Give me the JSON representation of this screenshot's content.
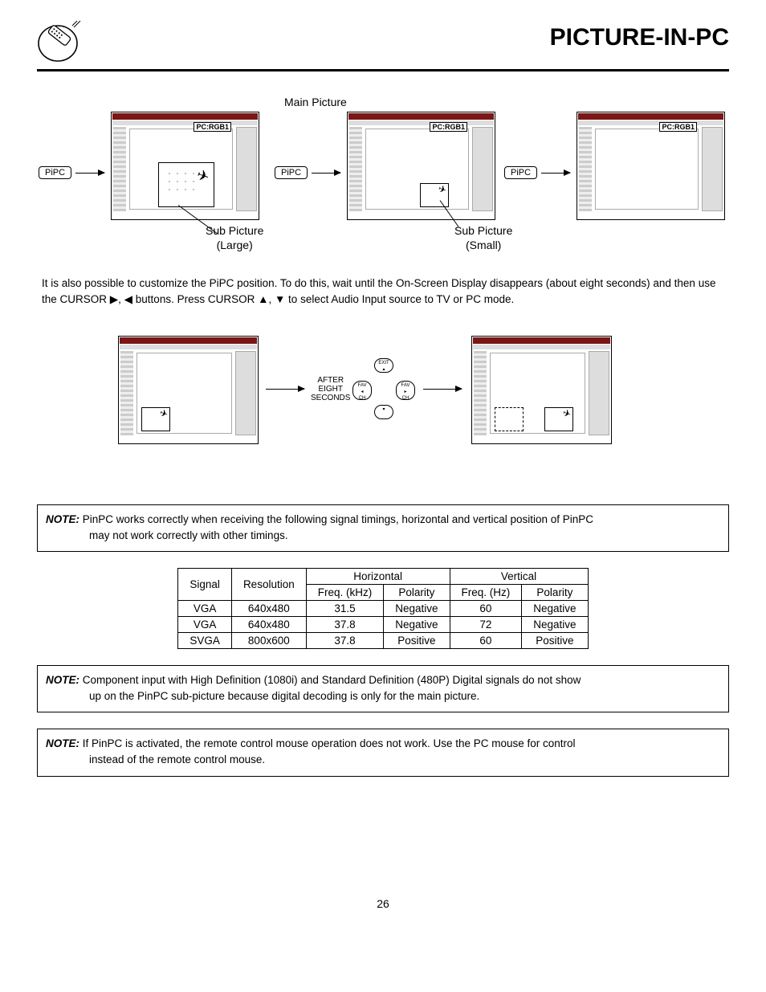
{
  "header": {
    "title": "PICTURE-IN-PC"
  },
  "diagram1": {
    "main_picture_label": "Main Picture",
    "pipc_button": "PiPC",
    "badge": "PC:RGB1",
    "sub_large_label_line1": "Sub Picture",
    "sub_large_label_line2": "(Large)",
    "sub_small_label_line1": "Sub Picture",
    "sub_small_label_line2": "(Small)"
  },
  "paragraph": "It is also possible to customize the PiPC position. To do this, wait until the On-Screen Display disappears (about eight seconds) and then use the CURSOR ▶, ◀ buttons. Press CURSOR ▲, ▼ to select Audio Input source to TV or PC mode.",
  "diagram2": {
    "after_label": "AFTER\nEIGHT\nSECONDS",
    "dpad": {
      "up": "EXIT\n▴",
      "left": "FAV\n◂\nCH",
      "right": "FAV\n▸\nCH",
      "down": "▾"
    }
  },
  "notes": {
    "label": "NOTE:",
    "note1": "PinPC works correctly when receiving the following signal timings, horizontal and vertical position of PinPC may not work correctly with other timings.",
    "note2": "Component input with High Definition (1080i) and Standard Definition (480P) Digital signals do not show up on the PinPC sub-picture because digital decoding is only for the main picture.",
    "note3": "If PinPC is activated, the remote control mouse operation does not work.  Use the PC mouse for control instead of the remote control mouse."
  },
  "table": {
    "headers": {
      "signal": "Signal",
      "resolution": "Resolution",
      "horizontal": "Horizontal",
      "vertical": "Vertical",
      "freq_khz": "Freq. (kHz)",
      "polarity": "Polarity",
      "freq_hz": "Freq. (Hz)"
    },
    "rows": [
      {
        "signal": "VGA",
        "resolution": "640x480",
        "h_freq": "31.5",
        "h_pol": "Negative",
        "v_freq": "60",
        "v_pol": "Negative"
      },
      {
        "signal": "VGA",
        "resolution": "640x480",
        "h_freq": "37.8",
        "h_pol": "Negative",
        "v_freq": "72",
        "v_pol": "Negative"
      },
      {
        "signal": "SVGA",
        "resolution": "800x600",
        "h_freq": "37.8",
        "h_pol": "Positive",
        "v_freq": "60",
        "v_pol": "Positive"
      }
    ]
  },
  "page_number": "26"
}
